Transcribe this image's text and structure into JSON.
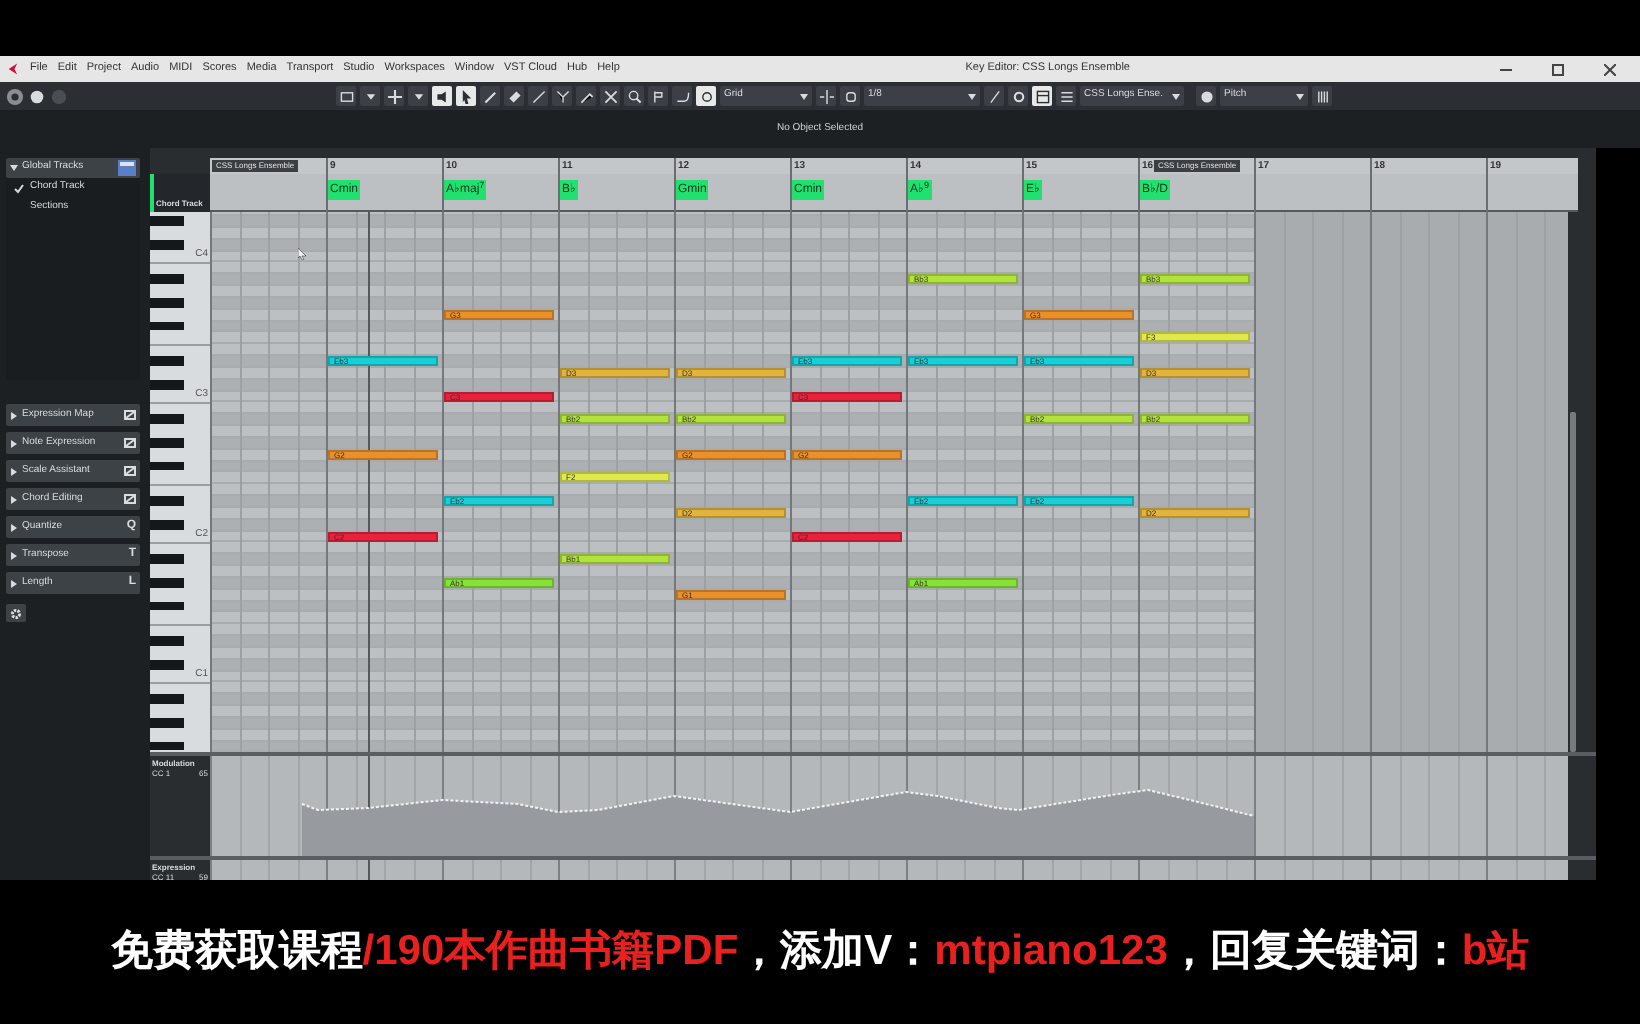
{
  "menu_bar": {
    "items": [
      "File",
      "Edit",
      "Project",
      "Audio",
      "MIDI",
      "Scores",
      "Media",
      "Transport",
      "Studio",
      "Workspaces",
      "Window",
      "VST Cloud",
      "Hub",
      "Help"
    ],
    "title": "Key Editor: CSS Longs Ensemble"
  },
  "toolbar": {
    "grid_mode": "Grid",
    "quantize": "1/8",
    "instrument": "CSS Longs Ense.",
    "controller": "Pitch"
  },
  "info_line": "No Object Selected",
  "inspector": {
    "global_tracks": {
      "title": "Global Tracks",
      "expanded": true,
      "items": [
        {
          "label": "Chord Track",
          "checked": true
        },
        {
          "label": "Sections",
          "checked": false
        }
      ]
    },
    "sections": [
      {
        "label": "Expression Map",
        "expanded": false
      },
      {
        "label": "Note Expression",
        "expanded": false
      },
      {
        "label": "Scale Assistant",
        "expanded": false
      },
      {
        "label": "Chord Editing",
        "expanded": false
      },
      {
        "label": "Quantize",
        "expanded": false,
        "glyph": "Q"
      },
      {
        "label": "Transpose",
        "expanded": false,
        "glyph": "T"
      },
      {
        "label": "Length",
        "expanded": false,
        "glyph": "L"
      }
    ]
  },
  "editor": {
    "chord_track_label": "Chord Track",
    "start_label": "CSS Longs Ensemble",
    "key_labels": [
      "C4",
      "C3",
      "C2",
      "C1"
    ],
    "bars": [
      {
        "number": "9",
        "chord": "Cmin",
        "notes": [
          {
            "pitch": "Eb3",
            "color": "#19cfd6"
          },
          {
            "pitch": "G2",
            "color": "#e8902c"
          },
          {
            "pitch": "C2",
            "color": "#e8223c"
          }
        ]
      },
      {
        "number": "10",
        "chord": "A♭maj$^{7}$",
        "notes": [
          {
            "pitch": "G3",
            "color": "#e8902c"
          },
          {
            "pitch": "C3",
            "color": "#e8223c"
          },
          {
            "pitch": "Eb2",
            "color": "#19cfd6"
          },
          {
            "pitch": "Ab1",
            "color": "#86e236"
          }
        ]
      },
      {
        "number": "11",
        "chord": "B♭",
        "notes": [
          {
            "pitch": "D3",
            "color": "#e2b43c"
          },
          {
            "pitch": "Bb2",
            "color": "#b2e23e"
          },
          {
            "pitch": "F2",
            "color": "#dfe84c"
          },
          {
            "pitch": "Bb1",
            "color": "#b2e23e"
          }
        ]
      },
      {
        "number": "12",
        "chord": "Gmin",
        "notes": [
          {
            "pitch": "D3",
            "color": "#e2b43c"
          },
          {
            "pitch": "Bb2",
            "color": "#b2e23e"
          },
          {
            "pitch": "G2",
            "color": "#e8902c"
          },
          {
            "pitch": "D2",
            "color": "#e2b43c"
          },
          {
            "pitch": "G1",
            "color": "#e8902c"
          }
        ]
      },
      {
        "number": "13",
        "chord": "Cmin",
        "notes": [
          {
            "pitch": "Eb3",
            "color": "#19cfd6"
          },
          {
            "pitch": "C3",
            "color": "#e8223c"
          },
          {
            "pitch": "G2",
            "color": "#e8902c"
          },
          {
            "pitch": "C2",
            "color": "#e8223c"
          }
        ]
      },
      {
        "number": "14",
        "chord": "A♭$^{9}$",
        "notes": [
          {
            "pitch": "Bb3",
            "color": "#b2e23e"
          },
          {
            "pitch": "Eb3",
            "color": "#19cfd6"
          },
          {
            "pitch": "Eb2",
            "color": "#19cfd6"
          },
          {
            "pitch": "Ab1",
            "color": "#86e236"
          }
        ]
      },
      {
        "number": "15",
        "chord": "E♭",
        "notes": [
          {
            "pitch": "G3",
            "color": "#e8902c"
          },
          {
            "pitch": "Eb3",
            "color": "#19cfd6"
          },
          {
            "pitch": "Bb2",
            "color": "#b2e23e"
          },
          {
            "pitch": "Eb2",
            "color": "#19cfd6"
          }
        ]
      },
      {
        "number": "16",
        "chord": "B♭/D",
        "label": "CSS Longs Ensemble",
        "notes": [
          {
            "pitch": "Bb3",
            "color": "#b2e23e"
          },
          {
            "pitch": "F3",
            "color": "#dfe84c"
          },
          {
            "pitch": "D3",
            "color": "#e2b43c"
          },
          {
            "pitch": "Bb2",
            "color": "#b2e23e"
          },
          {
            "pitch": "D2",
            "color": "#e2b43c"
          }
        ]
      },
      {
        "number": "17"
      },
      {
        "number": "18"
      },
      {
        "number": "19"
      }
    ],
    "lanes": [
      {
        "name": "Modulation",
        "cc": "CC 1",
        "value": "65"
      },
      {
        "name": "Expression",
        "cc": "CC 11",
        "value": "59"
      }
    ]
  },
  "caption": [
    {
      "text": "免费获取课程",
      "color": "#ffffff"
    },
    {
      "text": "/190本作曲书籍PDF",
      "color": "#e82020"
    },
    {
      "text": "，添加V：",
      "color": "#ffffff"
    },
    {
      "text": "mtpiano123",
      "color": "#e82020"
    },
    {
      "text": "，回复关键词：",
      "color": "#ffffff"
    },
    {
      "text": "b站",
      "color": "#e82020"
    }
  ]
}
